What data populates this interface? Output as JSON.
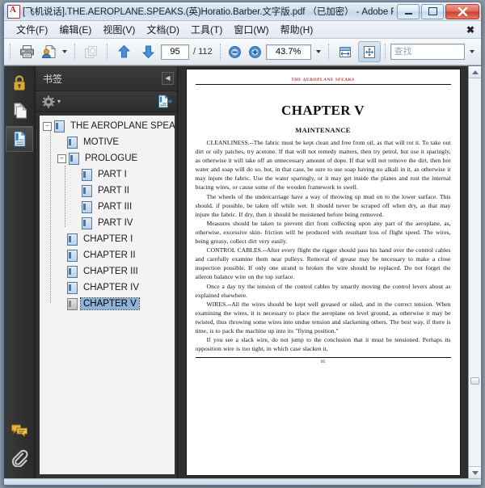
{
  "window": {
    "title": "[飞机说话].THE.AEROPLANE.SPEAKS.(英)Horatio.Barber.文字版.pdf （已加密） - Adobe Reader",
    "app_icon": "pdf-logo-icon",
    "minimize_label": "—",
    "maximize_label": "□",
    "close_label": "✕"
  },
  "menubar": {
    "items": [
      {
        "label": "文件(F)",
        "name": "menu-file"
      },
      {
        "label": "编辑(E)",
        "name": "menu-edit"
      },
      {
        "label": "视图(V)",
        "name": "menu-view"
      },
      {
        "label": "文档(D)",
        "name": "menu-document"
      },
      {
        "label": "工具(T)",
        "name": "menu-tools"
      },
      {
        "label": "窗口(W)",
        "name": "menu-window"
      },
      {
        "label": "帮助(H)",
        "name": "menu-help"
      }
    ],
    "close_doc_label": "✖"
  },
  "toolbar": {
    "print_icon": "printer-icon",
    "email_icon": "share-email-icon",
    "dropdown_caret": "▾",
    "copy_icon": "copy-snapshot-icon",
    "prev_page_icon": "arrow-up-icon",
    "next_page_icon": "arrow-down-icon",
    "page_number": "95",
    "page_total": "/ 112",
    "zoom_out_icon": "zoom-out-icon",
    "zoom_in_icon": "zoom-in-icon",
    "zoom_value": "43.7%",
    "fit_width_icon": "fit-width-icon",
    "fit_page_icon": "fit-page-icon",
    "find_placeholder": "查找",
    "find_value": ""
  },
  "navrail": {
    "items": [
      {
        "name": "security-lock-icon",
        "label": "安全性"
      },
      {
        "name": "pages-thumbnail-icon",
        "label": "页面缩览图"
      },
      {
        "name": "bookmarks-icon",
        "label": "书签",
        "active": true
      }
    ],
    "bottom_items": [
      {
        "name": "comments-icon",
        "label": "注释"
      },
      {
        "name": "attachments-icon",
        "label": "附件"
      }
    ]
  },
  "bookmarks_panel": {
    "title": "书签",
    "collapse_label": "◀",
    "options_icon": "gear-icon",
    "options_caret": "▾",
    "expand_current_icon": "expand-bookmark-icon",
    "items": [
      {
        "label": "THE AEROPLANE SPEAKS",
        "level": 0,
        "expander": "−",
        "icon": "bookmark-page-icon",
        "selected": false
      },
      {
        "label": "MOTIVE",
        "level": 1,
        "expander": "",
        "icon": "bookmark-page-icon",
        "selected": false
      },
      {
        "label": "PROLOGUE",
        "level": 1,
        "expander": "−",
        "icon": "bookmark-page-icon",
        "selected": false
      },
      {
        "label": "PART I",
        "level": 2,
        "expander": "",
        "icon": "bookmark-page-icon",
        "selected": false
      },
      {
        "label": "PART II",
        "level": 2,
        "expander": "",
        "icon": "bookmark-page-icon",
        "selected": false
      },
      {
        "label": "PART III",
        "level": 2,
        "expander": "",
        "icon": "bookmark-page-icon",
        "selected": false
      },
      {
        "label": "PART IV",
        "level": 2,
        "expander": "",
        "icon": "bookmark-page-icon",
        "selected": false
      },
      {
        "label": "CHAPTER I",
        "level": 1,
        "expander": "",
        "icon": "bookmark-page-icon",
        "selected": false
      },
      {
        "label": "CHAPTER II",
        "level": 1,
        "expander": "",
        "icon": "bookmark-page-icon",
        "selected": false
      },
      {
        "label": "CHAPTER III",
        "level": 1,
        "expander": "",
        "icon": "bookmark-page-icon",
        "selected": false
      },
      {
        "label": "CHAPTER IV",
        "level": 1,
        "expander": "",
        "icon": "bookmark-page-icon",
        "selected": false
      },
      {
        "label": "CHAPTER V",
        "level": 1,
        "expander": "",
        "icon": "bookmark-page-icon-grey",
        "selected": true
      }
    ]
  },
  "document": {
    "running_head": "THE AEROPLANE SPEAKS",
    "chapter_title": "CHAPTER V",
    "section_title": "MAINTENANCE",
    "folio": "95",
    "paragraphs": [
      "CLEANLINESS.--The fabric must be kept clean and free from oil, as that will rot it. To take out dirt or oily patches, try acetone. If that will not remedy matters, then try petrol, but use it sparingly, as otherwise it will take off an unnecessary amount of dope. If that will not remove the dirt, then hot water and soap will do so, but, in that case, be sure to use soap having no alkali in it, as otherwise it may injure the fabric. Use the water sparingly, or it may get inside the planes and rust the internal bracing wires, or cause some of the wooden framework to swell.",
      "The wheels of the undercarriage have a way of throwing up mud on to the lower surface. This should, if possible, be taken off while wet. It should never be scraped off when dry, as that may injure the fabric. If dry, then it should be moistened before being removed.",
      "Measures should be taken to prevent dirt from collecting upon any part of the aeroplane, as, otherwise, excessive skin- friction will be produced with resultant loss of flight speed. The wires, being greasy, collect dirt very easily.",
      "CONTROL CABLES.--After every flight the rigger should pass his hand over the control cables and carefully examine them near pulleys. Removal of grease may be necessary to make a close inspection possible. If only one strand is broken the wire should be replaced. Do not forget the aileron balance wire on the top surface.",
      "Once a day try the tension of the control cables by smartly moving the control levers about as explained elsewhere.",
      "WIRES.--All the wires should be kept well greased or oiled, and in the correct tension. When examining the wires, it is necessary to place the aeroplane on level ground, as otherwise it may be twisted, thus throwing some wires into undue tension and slackening others. The best way, if there is time, is to pack the machine up into its \"flying position.\"",
      "If you see a slack wire, do not jump to the conclusion that it must be tensioned. Perhaps its opposition wire is too tight, in which case slacken it,"
    ]
  },
  "scrollbar": {
    "up_arrow": "▲",
    "down_arrow": "▼"
  },
  "colors": {
    "accent_selected": "#8cb3d9",
    "rail_bg": "#303030",
    "panel_bg": "#323232",
    "running_head": "#c0352b",
    "close_button": "#c8402c"
  }
}
